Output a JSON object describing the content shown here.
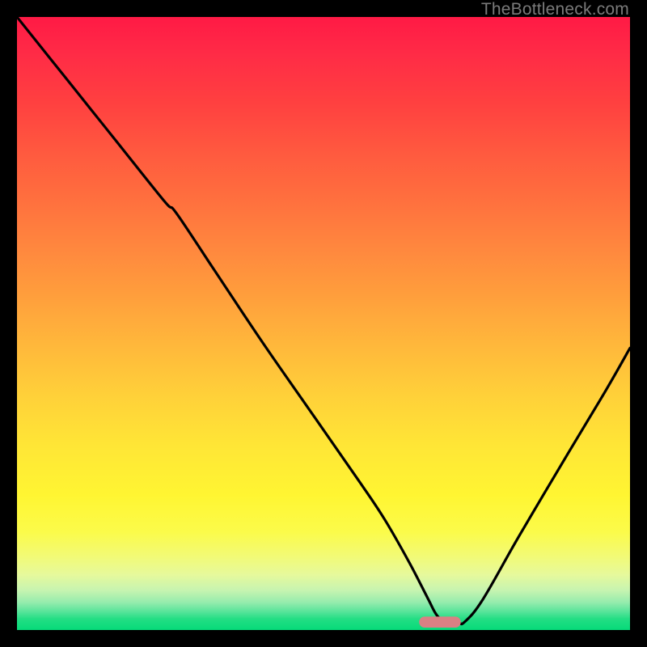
{
  "watermark": "TheBottleneck.com",
  "chart_data": {
    "type": "line",
    "title": "",
    "xlabel": "",
    "ylabel": "",
    "xlim": [
      0,
      100
    ],
    "ylim": [
      0,
      100
    ],
    "grid": false,
    "legend": false,
    "series": [
      {
        "name": "bottleneck-curve",
        "color": "#000000",
        "x": [
          0,
          8,
          16,
          24,
          26,
          32,
          40,
          48,
          56,
          60,
          64,
          67,
          68.5,
          70,
          72,
          73,
          76,
          82,
          90,
          96,
          100
        ],
        "y": [
          100,
          90,
          80,
          70,
          68,
          59,
          47,
          35.5,
          24,
          18,
          11,
          5.2,
          2.4,
          1.3,
          1.2,
          1.3,
          5,
          15.5,
          29,
          39,
          46
        ]
      }
    ],
    "marker": {
      "name": "optimum-band",
      "shape": "rounded-bar",
      "color": "#d98084",
      "x_center": 69,
      "y": 1.3,
      "width": 6.8,
      "height": 1.8
    },
    "background": {
      "type": "vertical-gradient",
      "stops": [
        {
          "pos": 0.0,
          "color": "#ff1a45"
        },
        {
          "pos": 0.5,
          "color": "#ffb93b"
        },
        {
          "pos": 0.8,
          "color": "#fff631"
        },
        {
          "pos": 1.0,
          "color": "#06da79"
        }
      ]
    }
  }
}
